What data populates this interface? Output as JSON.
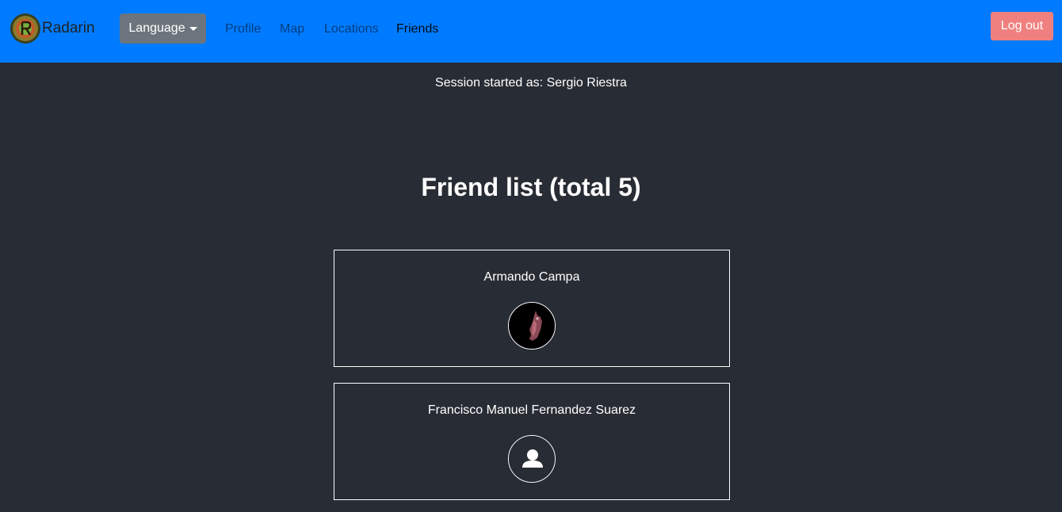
{
  "brand": {
    "name": "Radarin",
    "logo_icon": "radarin-logo-icon"
  },
  "nav": {
    "language_label": "Language",
    "links": [
      "Profile",
      "Map",
      "Locations",
      "Friends"
    ],
    "active": "Friends",
    "logout_label": "Log out"
  },
  "session": {
    "text": "Session started as: Sergio Riestra"
  },
  "friends": {
    "title": "Friend list (total 5)",
    "items": [
      {
        "name": "Armando Campa",
        "avatar": "photo"
      },
      {
        "name": "Francisco Manuel Fernandez Suarez",
        "avatar": "default-user-icon"
      }
    ]
  },
  "colors": {
    "navbar": "#007bff",
    "background": "#282c34",
    "language_button": "#6c757d",
    "logout_button": "#f08080"
  }
}
